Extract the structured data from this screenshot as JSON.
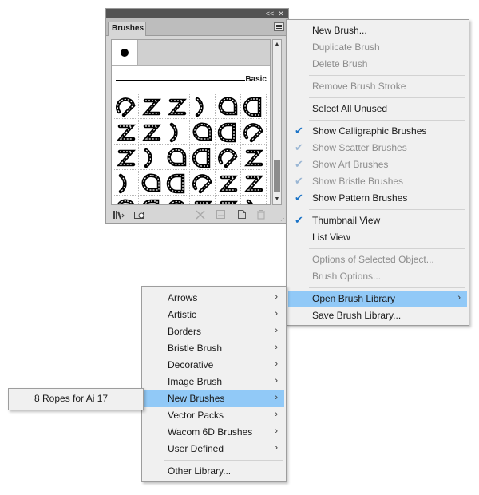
{
  "panel": {
    "collapse_label": "<<",
    "close_label": "✕",
    "tab_title": "Brushes",
    "basic_label": "Basic",
    "footer_icons": [
      "brush-libraries-icon",
      "libraries-panel-icon",
      "remove-stroke-icon",
      "options-icon",
      "new-brush-icon",
      "delete-brush-icon"
    ]
  },
  "brush_menu": {
    "items": [
      {
        "label": "New Brush...",
        "enabled": true
      },
      {
        "label": "Duplicate Brush",
        "enabled": false
      },
      {
        "label": "Delete Brush",
        "enabled": false
      },
      {
        "label": "Remove Brush Stroke",
        "enabled": false
      },
      {
        "label": "Select All Unused",
        "enabled": true
      },
      {
        "label": "Show Calligraphic Brushes",
        "enabled": true,
        "checked": true
      },
      {
        "label": "Show Scatter Brushes",
        "enabled": false,
        "checked": true
      },
      {
        "label": "Show Art Brushes",
        "enabled": false,
        "checked": true
      },
      {
        "label": "Show Bristle Brushes",
        "enabled": false,
        "checked": true
      },
      {
        "label": "Show Pattern Brushes",
        "enabled": true,
        "checked": true
      },
      {
        "label": "Thumbnail View",
        "enabled": true,
        "checked": true
      },
      {
        "label": "List View",
        "enabled": true
      },
      {
        "label": "Options of Selected Object...",
        "enabled": false
      },
      {
        "label": "Brush Options...",
        "enabled": false
      },
      {
        "label": "Open Brush Library",
        "enabled": true,
        "submenu": true,
        "highlighted": true
      },
      {
        "label": "Save Brush Library...",
        "enabled": true
      }
    ]
  },
  "library_menu": {
    "items": [
      {
        "label": "Arrows",
        "submenu": true
      },
      {
        "label": "Artistic",
        "submenu": true
      },
      {
        "label": "Borders",
        "submenu": true
      },
      {
        "label": "Bristle Brush",
        "submenu": true
      },
      {
        "label": "Decorative",
        "submenu": true
      },
      {
        "label": "Image Brush",
        "submenu": true
      },
      {
        "label": "New Brushes",
        "submenu": true,
        "highlighted": true
      },
      {
        "label": "Vector Packs",
        "submenu": true
      },
      {
        "label": "Wacom 6D Brushes",
        "submenu": true
      },
      {
        "label": "User Defined",
        "submenu": true
      },
      {
        "label": "Other Library..."
      }
    ]
  },
  "new_brushes_menu": {
    "items": [
      {
        "label": "8 Ropes for Ai 17"
      }
    ]
  },
  "colors": {
    "highlight": "#91c9f7",
    "check": "#1a73c7"
  }
}
